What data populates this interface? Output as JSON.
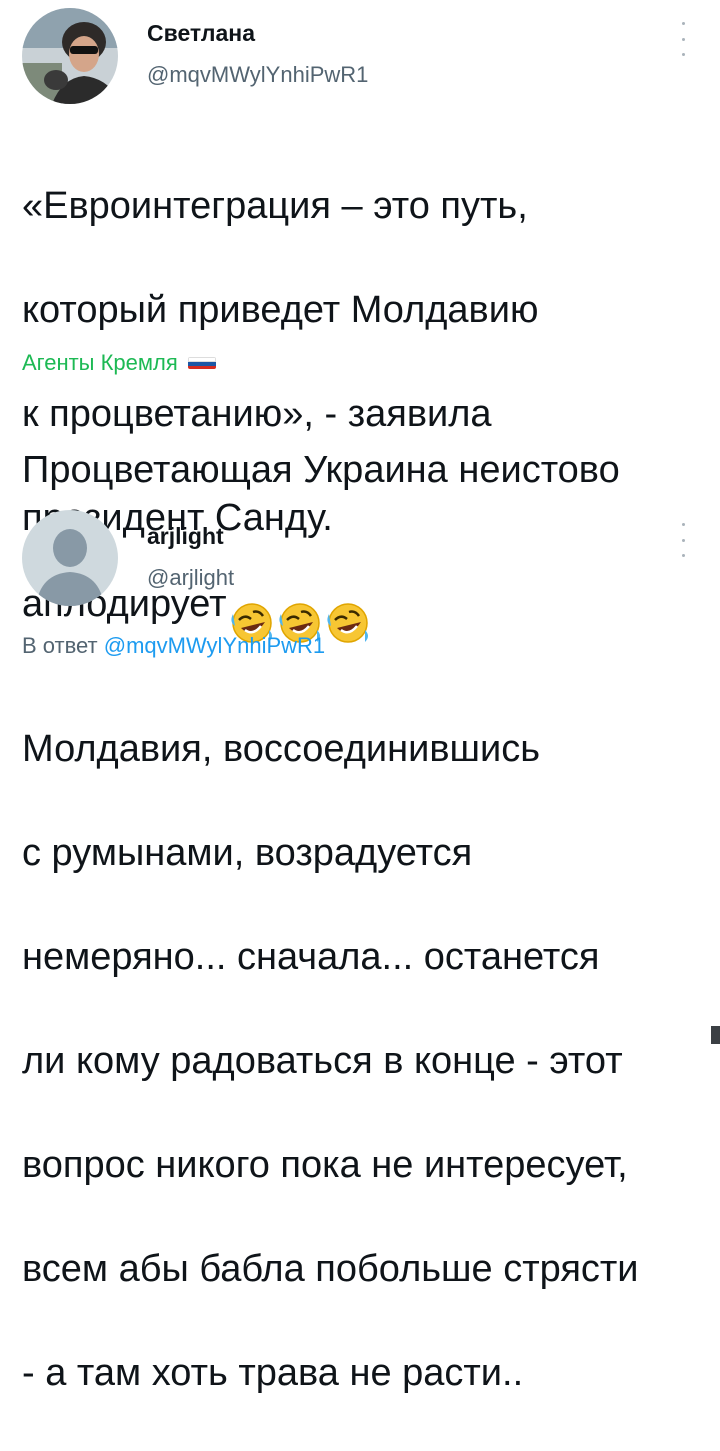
{
  "tweet1": {
    "display_name": "Светлана",
    "handle": "@mqvMWylYnhiPwR1",
    "text_lines": [
      "«Евроинтеграция – это путь,",
      "который приведет Молдавию",
      "к процветанию», - заявила",
      "президент Санду."
    ],
    "quote_label": "Агенты Кремля",
    "comment_lines": [
      "Процветающая Украина неистово",
      "аплодирует"
    ],
    "emoji": [
      "rolling-on-floor-laughing",
      "rolling-on-floor-laughing",
      "rolling-on-floor-laughing"
    ]
  },
  "tweet2": {
    "display_name": "arjlight",
    "handle": "@arjlight",
    "reply_prefix": "В ответ",
    "reply_mention": "@mqvMWylYnhiPwR1",
    "text_lines": [
      "Молдавия, воссоединившись",
      "с румынами, возрадуется",
      "немеряно... сначала... останется",
      "ли кому радоваться в конце - этот",
      "вопрос никого пока не интересует,",
      "всем абы бабла побольше стрясти",
      "- а там хоть трава не расти.."
    ]
  },
  "colors": {
    "text": "#0f1419",
    "secondary": "#536471",
    "link": "#1d9bf0",
    "channel_green": "#1db954"
  }
}
